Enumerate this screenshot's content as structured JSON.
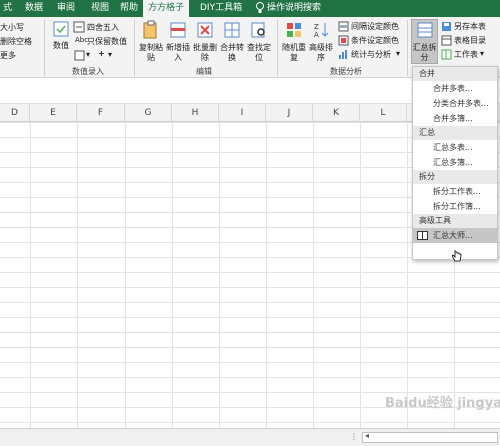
{
  "tabs": [
    "式",
    "数据",
    "审阅",
    "视图",
    "帮助",
    "方方格子",
    "DIY工具箱",
    "操作说明搜索"
  ],
  "ribbon": {
    "left_items": [
      "大小写",
      "删除空格",
      "更多"
    ],
    "numeric_group": {
      "label": "数值录入",
      "value_button": "数值",
      "round": "四舍五入",
      "keep_value": "只保留数值",
      "plus": "+"
    },
    "edit_group": {
      "label": "编辑",
      "buttons": [
        "复制粘\n贴",
        "新增插\n入",
        "批量删\n除",
        "合并转\n换",
        "查找定\n位"
      ]
    },
    "analysis_group": {
      "label": "数据分析",
      "buttons": [
        "随机重\n复",
        "高级排\n序"
      ],
      "items": [
        "间隔设定颜色",
        "条件设定颜色",
        "统计与分析"
      ]
    },
    "summary_group": {
      "big_button": "汇总拆\n分",
      "items": [
        "另存本表",
        "表格目录",
        "工作表"
      ]
    }
  },
  "columns": [
    "D",
    "E",
    "F",
    "G",
    "H",
    "I",
    "J",
    "K",
    "L"
  ],
  "dropdown": {
    "sections": [
      {
        "title": "合并",
        "items": [
          "合并多表...",
          "分类合并多表...",
          "合并多簿..."
        ]
      },
      {
        "title": "汇总",
        "items": [
          "汇总多表...",
          "汇总多簿..."
        ]
      },
      {
        "title": "拆分",
        "items": [
          "拆分工作表...",
          "拆分工作簿..."
        ]
      },
      {
        "title": "高级工具",
        "items": [
          "汇总大师..."
        ]
      }
    ]
  },
  "watermark": "Baidu经验 jingyan.baidu.com",
  "colors": {
    "accent": "#217346",
    "highlight": "#c6c6c6"
  }
}
